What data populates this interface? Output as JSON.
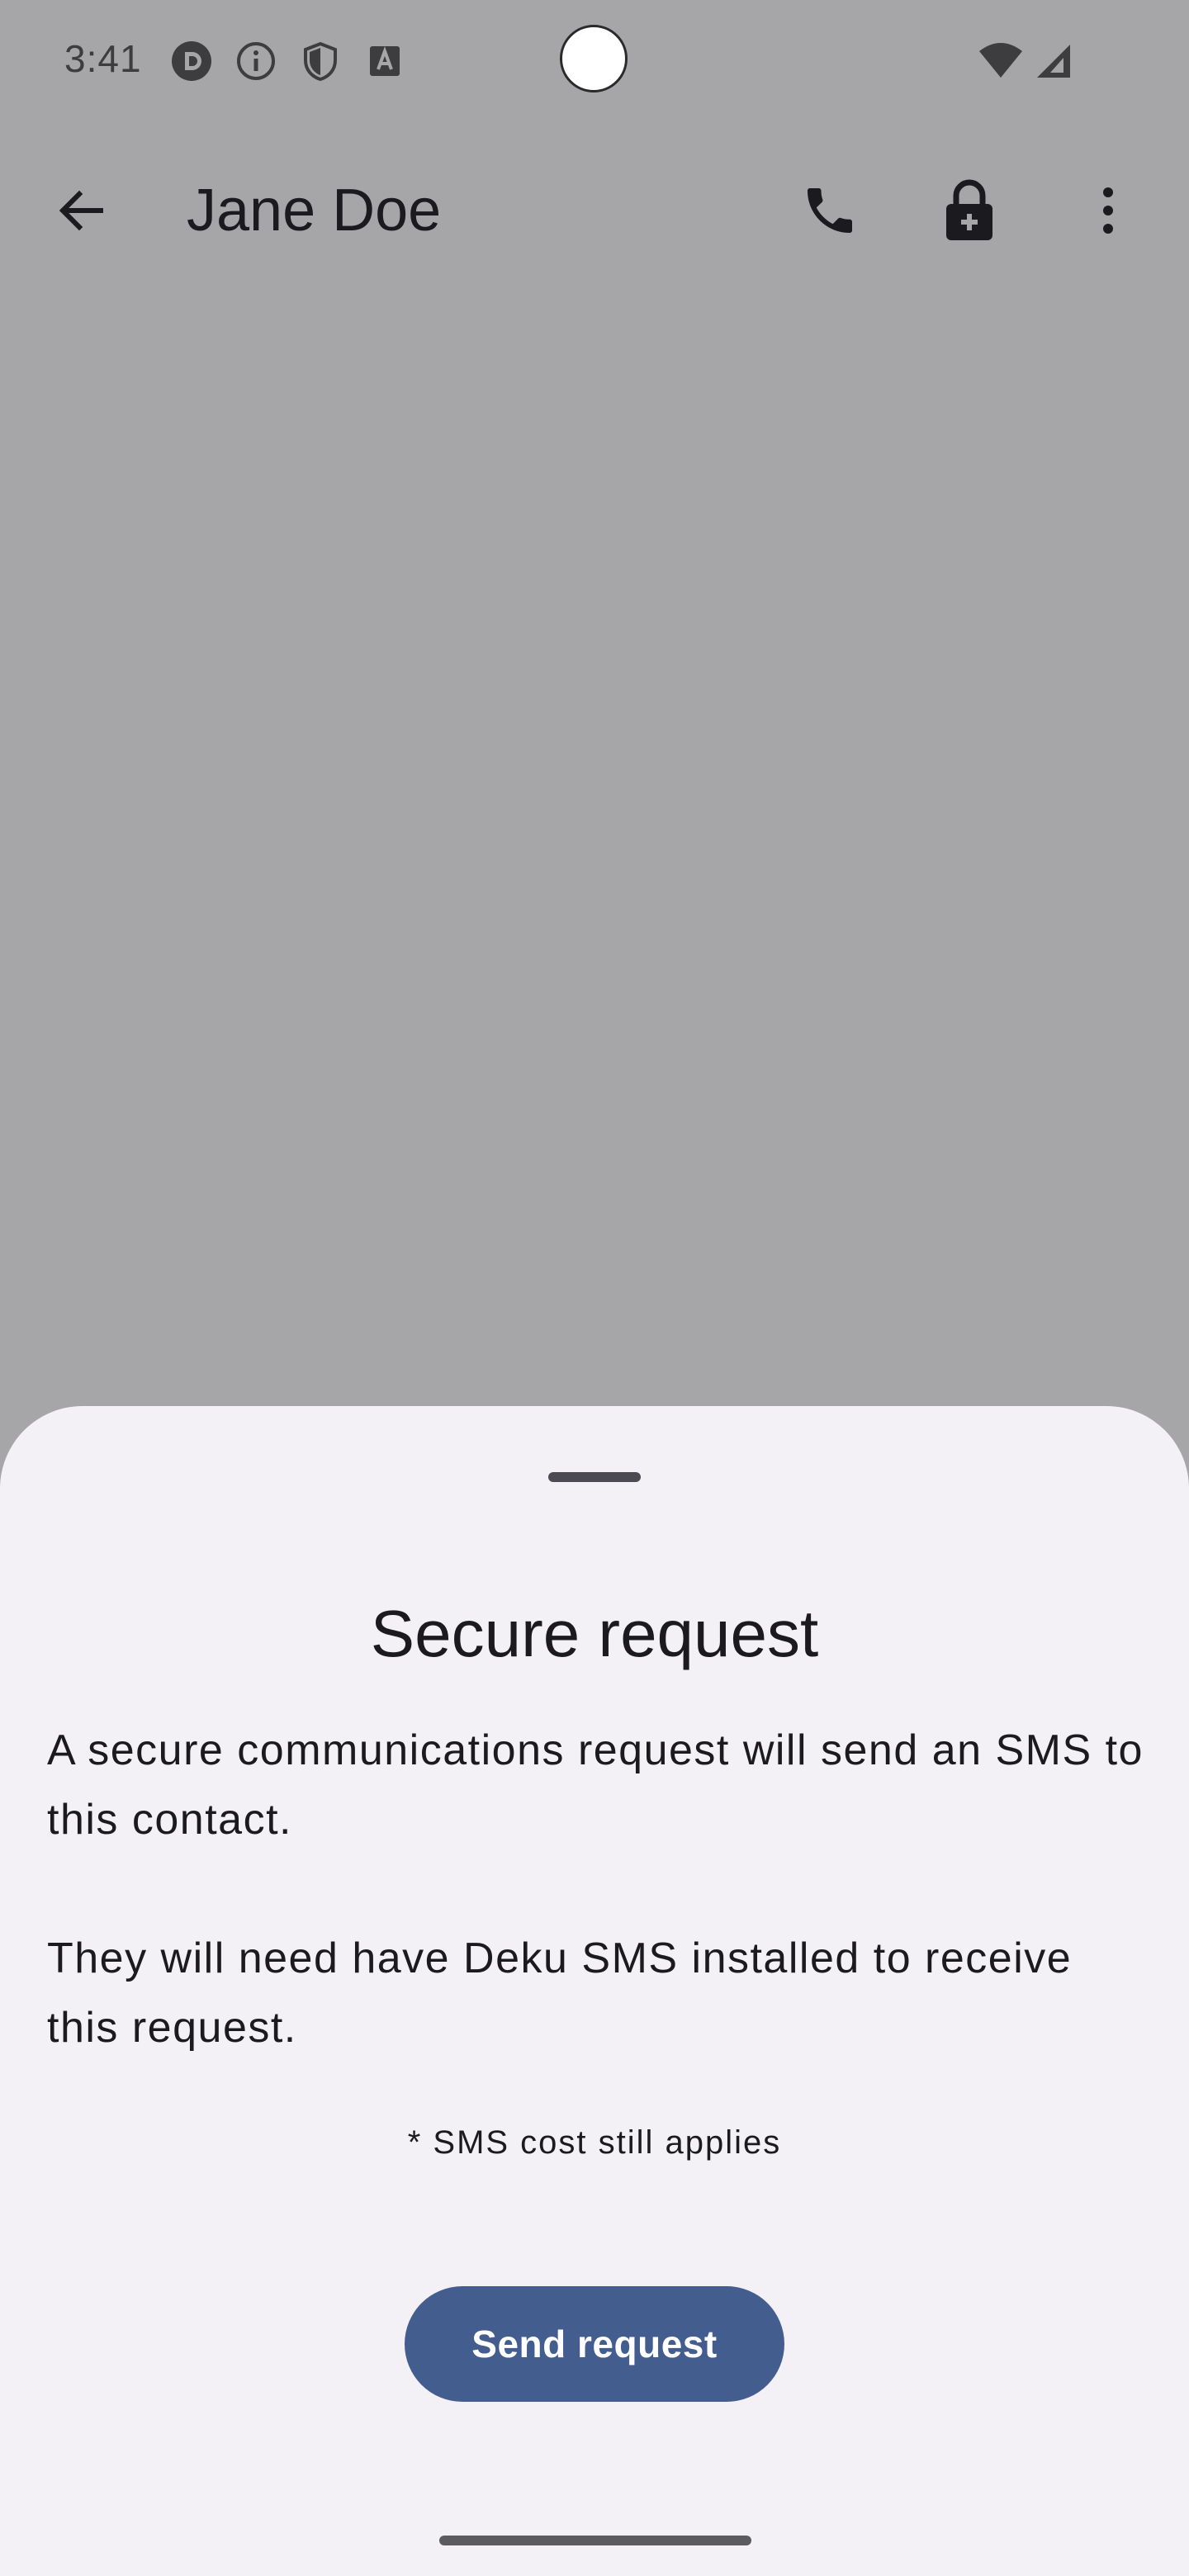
{
  "status_bar": {
    "time": "3:41",
    "icons": [
      "notification-d-icon",
      "info-icon",
      "shield-icon",
      "text-a-icon",
      "wifi-icon",
      "cellular-signal-icon"
    ]
  },
  "app_bar": {
    "title": "Jane Doe",
    "icons": [
      "back-arrow-icon",
      "phone-icon",
      "lock-plus-icon",
      "more-vert-icon"
    ]
  },
  "sheet": {
    "title": "Secure request",
    "paragraphs": [
      "A secure communications request will send an SMS to this contact.",
      "They will need have Deku SMS installed to receive this request."
    ],
    "note": "* SMS cost still applies",
    "button_label": "Send request"
  },
  "colors": {
    "scrim": "#a6a6a8",
    "sheet_background": "#f3f1f6",
    "button": "#445d8f",
    "text": "#1b1b1f"
  }
}
